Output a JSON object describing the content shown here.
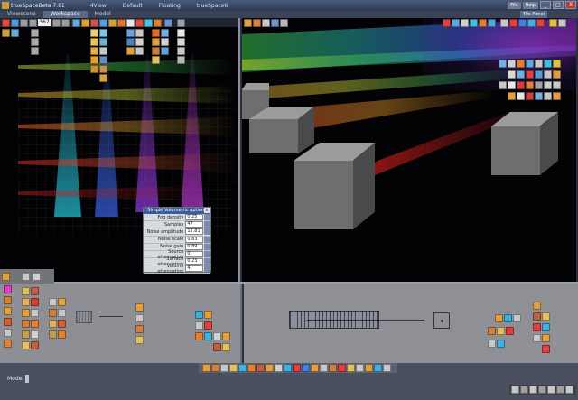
{
  "window": {
    "title": "trueSpaceBeta 7.61",
    "menu": [
      "4View",
      "Default",
      "Floating",
      "trueSpace6"
    ],
    "file_label": "File",
    "help_label": "Help",
    "min": "_",
    "max": "□",
    "close": "X"
  },
  "tabs": [
    "Viewscene",
    "Workspace",
    "Model"
  ],
  "toolbar": {
    "frame_value": "367"
  },
  "right_panel": {
    "title": "Tile Panel"
  },
  "volumetric": {
    "title": "Simple Volumetric options",
    "close": "x",
    "rows": [
      {
        "label": "Fog density",
        "value": "0.25"
      },
      {
        "label": "Samples",
        "value": "47"
      },
      {
        "label": "Noise amplitude",
        "value": "12.81"
      },
      {
        "label": "Noise scale",
        "value": "0.83"
      },
      {
        "label": "Noise gain",
        "value": "0.89"
      },
      {
        "label": "Source attenuation",
        "value": "0"
      },
      {
        "label": "Surface attenuation",
        "value": "0.23"
      },
      {
        "label": "Volume attenuation",
        "value": "4"
      }
    ]
  },
  "status": {
    "mode": "Model"
  },
  "colors": {
    "accent": "#3d5c9e",
    "close": "#b83a2e",
    "viewport_bg": "#020204",
    "panel_bg": "#8d8f94"
  }
}
